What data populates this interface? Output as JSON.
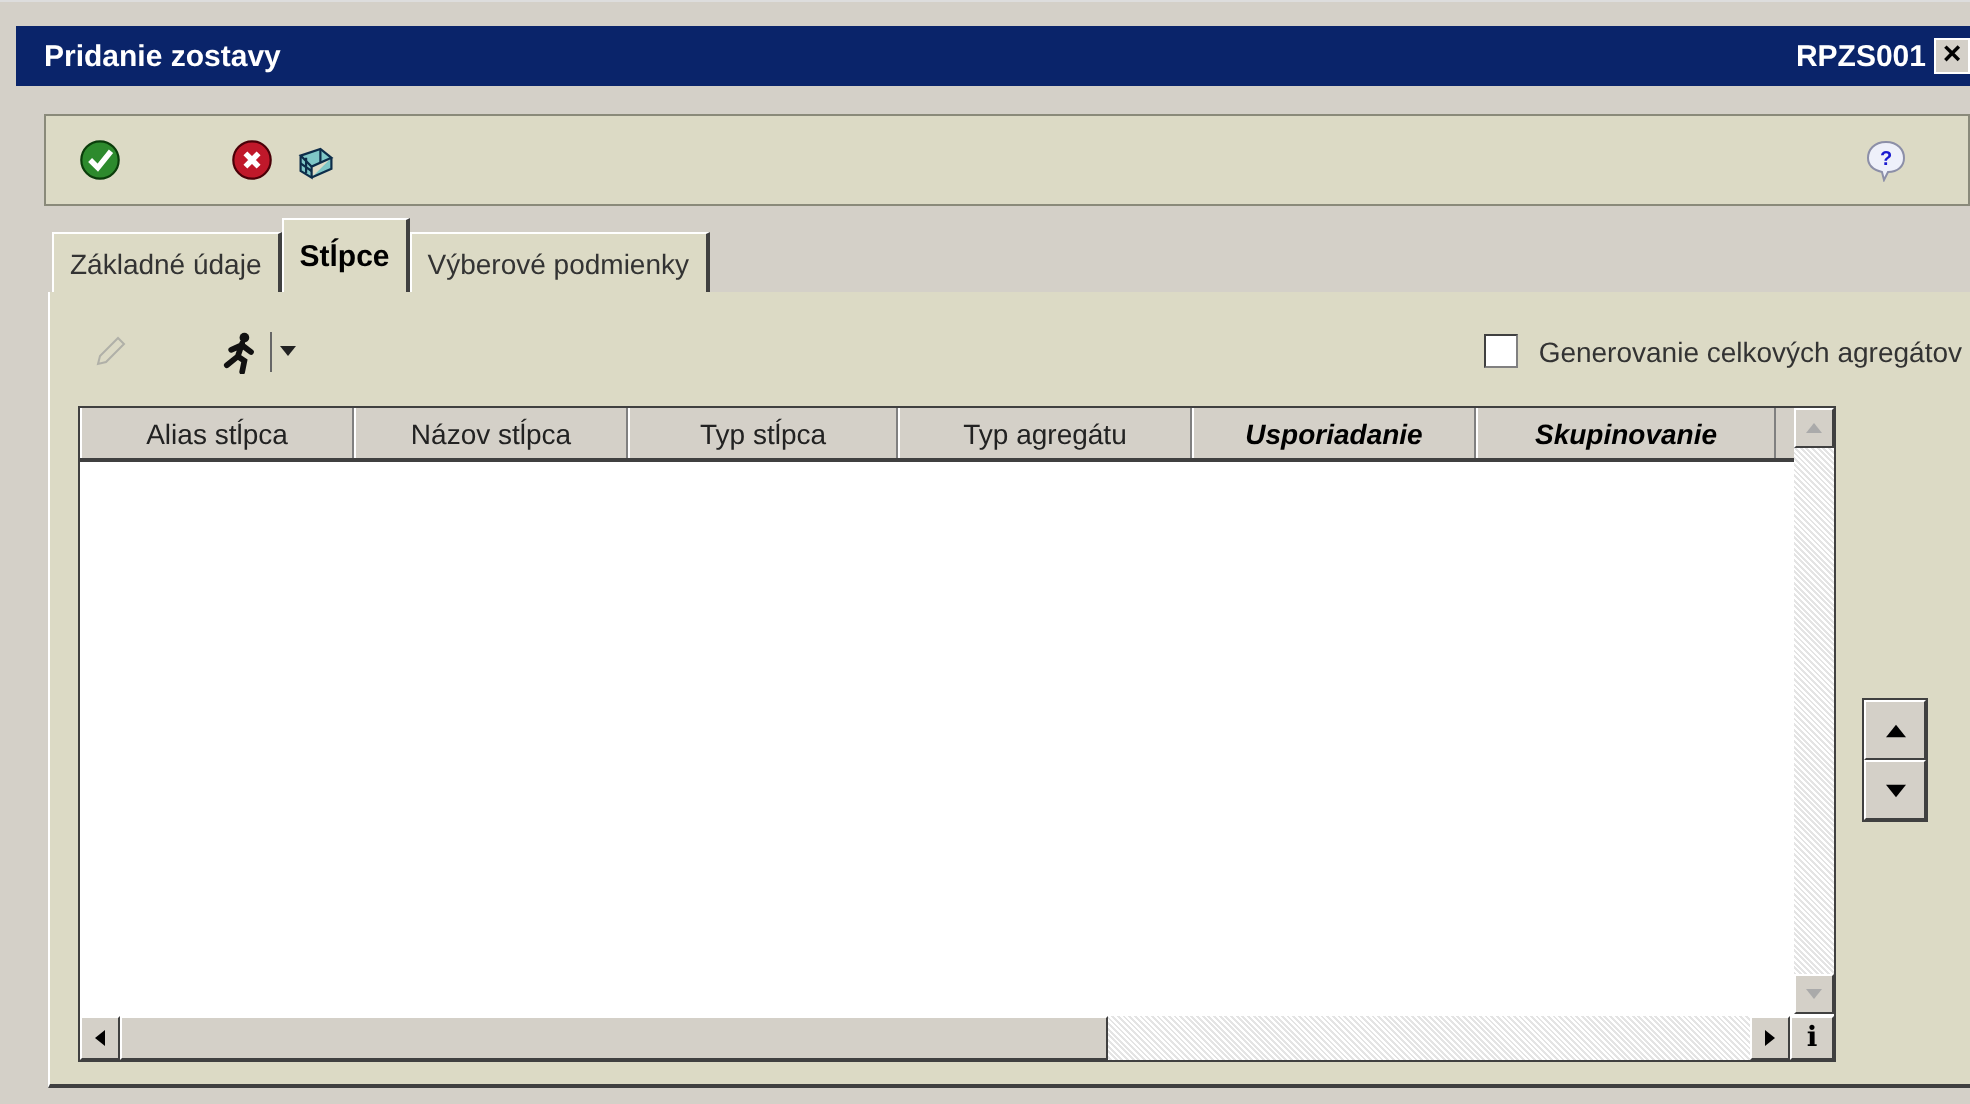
{
  "window": {
    "title": "Pridanie zostavy",
    "code": "RPZS001",
    "close_glyph": "×"
  },
  "tabs": [
    {
      "label": "Základné údaje",
      "selected": false
    },
    {
      "label": "Stĺpce",
      "selected": true
    },
    {
      "label": "Výberové podmienky",
      "selected": false
    }
  ],
  "help_glyph": "?",
  "edit_button": {
    "disabled": true
  },
  "aggregates_checkbox": {
    "label": "Generovanie celkových agregátov",
    "checked": false
  },
  "table": {
    "columns": [
      {
        "label": "Alias stĺpca",
        "emphasized": false
      },
      {
        "label": "Názov stĺpca",
        "emphasized": false
      },
      {
        "label": "Typ stĺpca",
        "emphasized": false
      },
      {
        "label": "Typ agregátu",
        "emphasized": false
      },
      {
        "label": "Usporiadanie",
        "emphasized": true
      },
      {
        "label": "Skupinovanie",
        "emphasized": true
      }
    ],
    "info_glyph": "i"
  }
}
